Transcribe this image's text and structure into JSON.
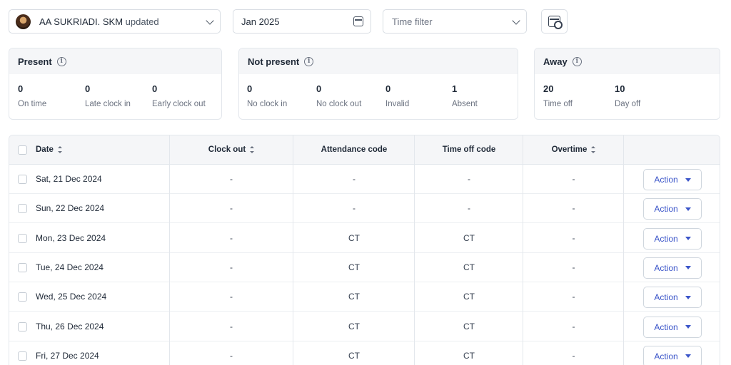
{
  "filters": {
    "employee_name": "AA SUKRIADI. SKM",
    "employee_status": "updated",
    "month": "Jan 2025",
    "time_filter_placeholder": "Time filter"
  },
  "summary": {
    "present": {
      "title": "Present",
      "stats": [
        {
          "value": "0",
          "label": "On time"
        },
        {
          "value": "0",
          "label": "Late clock in"
        },
        {
          "value": "0",
          "label": "Early clock out"
        }
      ]
    },
    "not_present": {
      "title": "Not present",
      "stats": [
        {
          "value": "0",
          "label": "No clock in"
        },
        {
          "value": "0",
          "label": "No clock out"
        },
        {
          "value": "0",
          "label": "Invalid"
        },
        {
          "value": "1",
          "label": "Absent"
        }
      ]
    },
    "away": {
      "title": "Away",
      "stats": [
        {
          "value": "20",
          "label": "Time off"
        },
        {
          "value": "10",
          "label": "Day off"
        }
      ]
    }
  },
  "table": {
    "headers": {
      "date": "Date",
      "clock_out": "Clock out",
      "attendance_code": "Attendance code",
      "time_off_code": "Time off code",
      "overtime": "Overtime"
    },
    "action_label": "Action",
    "rows": [
      {
        "date": "Sat, 21 Dec 2024",
        "clock_out": "-",
        "attendance_code": "-",
        "time_off_code": "-",
        "overtime": "-"
      },
      {
        "date": "Sun, 22 Dec 2024",
        "clock_out": "-",
        "attendance_code": "-",
        "time_off_code": "-",
        "overtime": "-"
      },
      {
        "date": "Mon, 23 Dec 2024",
        "clock_out": "-",
        "attendance_code": "CT",
        "time_off_code": "CT",
        "overtime": "-"
      },
      {
        "date": "Tue, 24 Dec 2024",
        "clock_out": "-",
        "attendance_code": "CT",
        "time_off_code": "CT",
        "overtime": "-"
      },
      {
        "date": "Wed, 25 Dec 2024",
        "clock_out": "-",
        "attendance_code": "CT",
        "time_off_code": "CT",
        "overtime": "-"
      },
      {
        "date": "Thu, 26 Dec 2024",
        "clock_out": "-",
        "attendance_code": "CT",
        "time_off_code": "CT",
        "overtime": "-"
      },
      {
        "date": "Fri, 27 Dec 2024",
        "clock_out": "-",
        "attendance_code": "CT",
        "time_off_code": "CT",
        "overtime": "-"
      }
    ]
  },
  "colors": {
    "accent": "#3b55c9",
    "header_bg": "#f5f6f8",
    "border": "#e3e7ec"
  }
}
